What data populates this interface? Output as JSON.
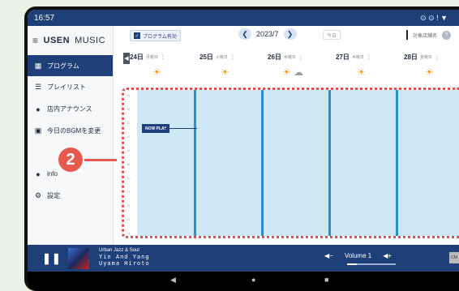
{
  "status": {
    "time": "16:57",
    "icons": "⊙ ⊙ ! ▼"
  },
  "sidebar": {
    "brand_bold": "USEN",
    "brand_light": "MUSIC",
    "items": [
      {
        "label": "プログラム",
        "icon": "grid-icon"
      },
      {
        "label": "プレイリスト",
        "icon": "playlist-icon"
      },
      {
        "label": "店内アナウンス",
        "icon": "speech-icon"
      },
      {
        "label": "今日のBGMを変更",
        "icon": "car-icon"
      },
      {
        "label": "info",
        "icon": "info-icon"
      },
      {
        "label": "設定",
        "icon": "settings-icon"
      }
    ],
    "callout": "2"
  },
  "toolbar": {
    "program_label": "プログラム有効",
    "month": "2023/7",
    "today": "今日",
    "right_label": "対象店舗名"
  },
  "days": [
    {
      "date": "24日",
      "weekday": "月曜日",
      "weather": "sun"
    },
    {
      "date": "25日",
      "weekday": "火曜日",
      "weather": "sun"
    },
    {
      "date": "26日",
      "weekday": "水曜日",
      "weather": "cloud"
    },
    {
      "date": "27日",
      "weekday": "木曜日",
      "weather": "sun"
    },
    {
      "date": "28日",
      "weekday": "金曜日",
      "weather": "sun"
    }
  ],
  "schedule": {
    "now_play": "NOW PLAY",
    "hours": [
      "14",
      "15",
      "16",
      "17",
      "18",
      "19",
      "20",
      "21",
      "22",
      "23",
      "24"
    ]
  },
  "player": {
    "genre": "Urban Jazz & Soul",
    "title": "Yin And Yang",
    "artist": "Uyama Hiroto",
    "volume_label": "Volume 1",
    "volume_level": 0.2,
    "cm_label": "CM"
  },
  "colors": {
    "accent": "#1e3f78",
    "grid": "#cfe8f5",
    "callout": "#e85a50"
  }
}
